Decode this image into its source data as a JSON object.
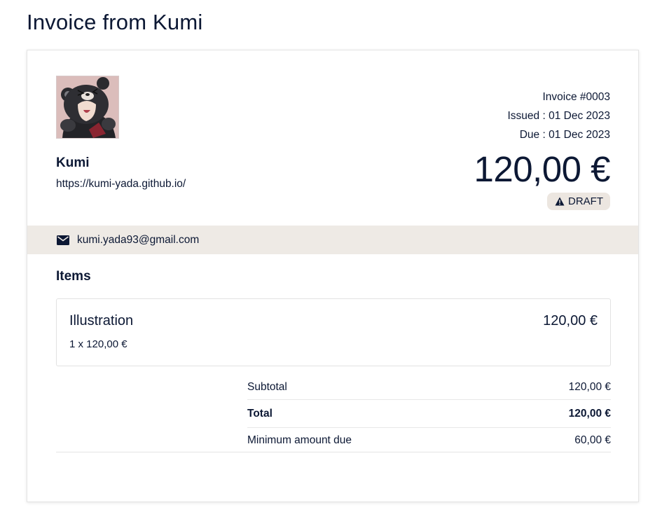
{
  "page": {
    "title": "Invoice from Kumi"
  },
  "sender": {
    "avatar_icon": "avatar-bear-illustration",
    "name": "Kumi",
    "website": "https://kumi-yada.github.io/",
    "email": "kumi.yada93@gmail.com"
  },
  "invoice": {
    "number": "Invoice #0003",
    "issued": "Issued : 01 Dec 2023",
    "due": "Due : 01 Dec 2023",
    "amount": "120,00 €",
    "status": "DRAFT",
    "status_icon": "warning-icon"
  },
  "items": {
    "heading": "Items",
    "list": [
      {
        "name": "Illustration",
        "price": "120,00 €",
        "quantity": "1 x 120,00 €"
      }
    ]
  },
  "totals": {
    "subtotal_label": "Subtotal",
    "subtotal_value": "120,00 €",
    "total_label": "Total",
    "total_value": "120,00 €",
    "minimum_label": "Minimum amount due",
    "minimum_value": "60,00 €"
  },
  "colors": {
    "text": "#0c1834",
    "contact_bar_bg": "#eeeae5",
    "badge_bg": "#ece6e0",
    "avatar_bg": "#dbbdbb"
  }
}
